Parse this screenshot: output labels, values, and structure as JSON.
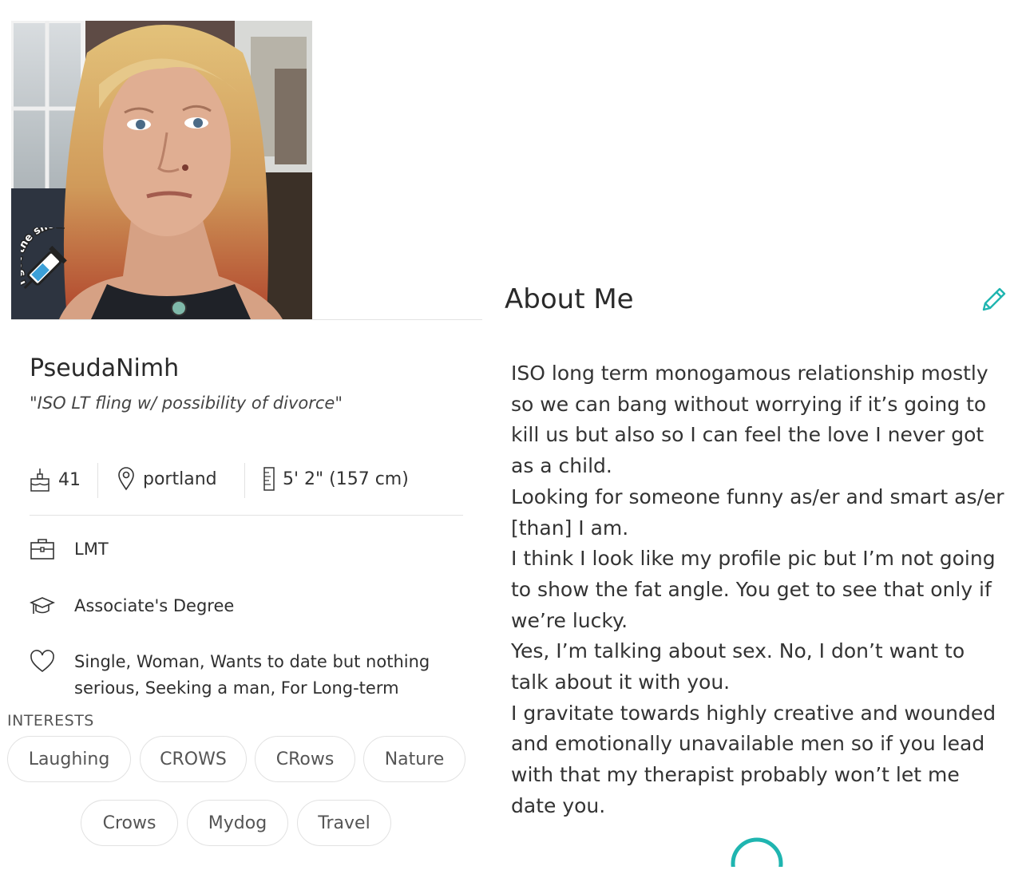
{
  "profile": {
    "username": "PseudaNimh",
    "tagline": "\"ISO LT fling w/ possibility of divorce\"",
    "photo_sticker_text": "I got the shot!"
  },
  "stats": {
    "age": "41",
    "location": "portland",
    "height": "5' 2\" (157 cm)"
  },
  "details": {
    "occupation": "LMT",
    "education": "Associate's Degree",
    "relationship": "Single, Woman, Wants to date but nothing serious, Seeking a man, For Long-term"
  },
  "interests": {
    "label": "INTERESTS",
    "items": [
      "Laughing",
      "CROWS",
      "CRows",
      "Nature",
      "Crows",
      "Mydog",
      "Travel"
    ]
  },
  "about": {
    "title": "About Me",
    "paragraphs": [
      "ISO long term monogamous relationship mostly so we can bang without worrying if it’s going to kill us but also so I can feel the love I never got as a child.",
      "Looking for someone funny as/er and smart as/er [than] I am.",
      "I think I look like my profile pic but I’m not going to show the fat angle. You get to see that only if we’re lucky.",
      "Yes, I’m talking about sex. No, I don’t want to talk about it with you.",
      "I gravitate towards highly creative and wounded and emotionally unavailable men so if you lead with that my therapist probably won’t let me date you."
    ]
  },
  "icons": {
    "age": "cake-icon",
    "location": "location-pin-icon",
    "height": "ruler-icon",
    "occupation": "briefcase-icon",
    "education": "graduation-cap-icon",
    "relationship": "heart-icon",
    "edit": "pencil-icon"
  },
  "colors": {
    "accent": "#1fb5b0",
    "text": "#2a2a2a",
    "border": "#e2e2e2"
  }
}
